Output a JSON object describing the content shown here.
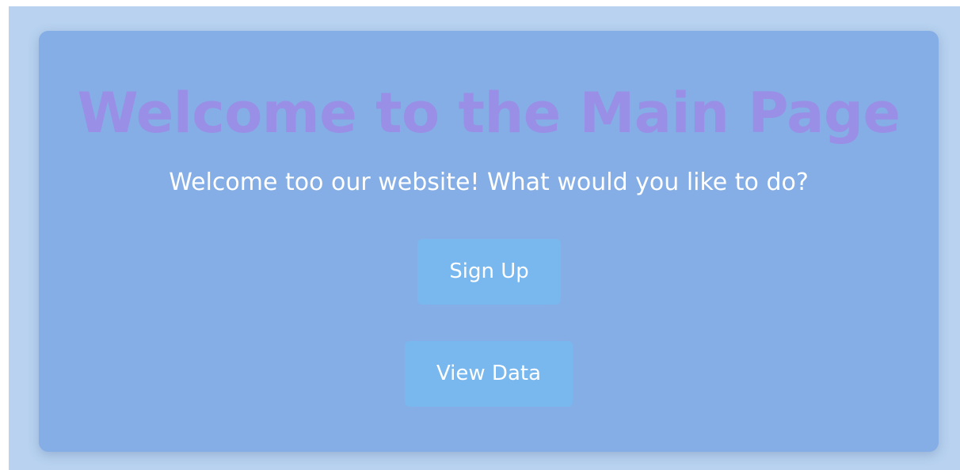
{
  "main": {
    "title": "Welcome to the Main Page",
    "subtitle": "Welcome too our website! What would you like to do?"
  },
  "actions": {
    "sign_up_label": "Sign Up",
    "view_data_label": "View Data"
  },
  "colors": {
    "page_background": "#b8d2f0",
    "card_background": "#84aee5",
    "title_color": "#9a8fe6",
    "button_background": "#79b8ee",
    "text_light": "#ffffff"
  }
}
